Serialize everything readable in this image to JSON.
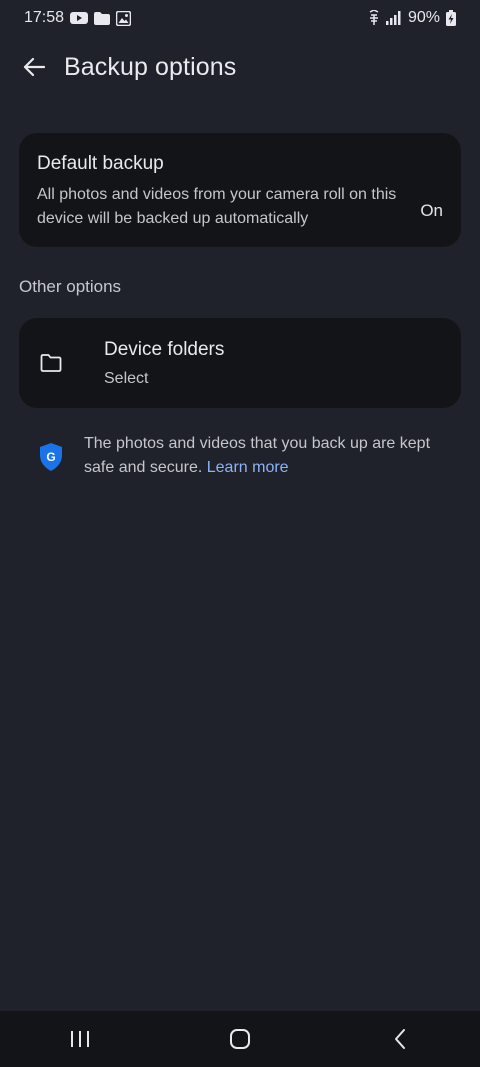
{
  "status_bar": {
    "time": "17:58",
    "battery": "90%",
    "left_icons": [
      "youtube-icon",
      "folder-icon",
      "gallery-icon"
    ],
    "right_icons": [
      "alarm-icon",
      "signal-icon",
      "battery-icon"
    ]
  },
  "header": {
    "back_icon": "arrow-left-icon",
    "title": "Backup options"
  },
  "default_backup": {
    "title": "Default backup",
    "description": "All photos and videos from your camera roll on this device will be backed up automatically",
    "state": "On"
  },
  "other_options": {
    "label": "Other options",
    "device_folders": {
      "icon": "folder-outline-icon",
      "title": "Device folders",
      "subtitle": "Select"
    }
  },
  "info": {
    "icon": "google-shield-icon",
    "text": "The photos and videos that you back up are kept safe and secure.",
    "link": "Learn more"
  },
  "navigation": {
    "recents_icon": "recents-icon",
    "home_icon": "home-icon",
    "back_icon": "back-chevron-icon"
  },
  "colors": {
    "background": "#1f222a",
    "card": "#121418",
    "link": "#8ab4f8",
    "shield": "#1a73e8"
  }
}
